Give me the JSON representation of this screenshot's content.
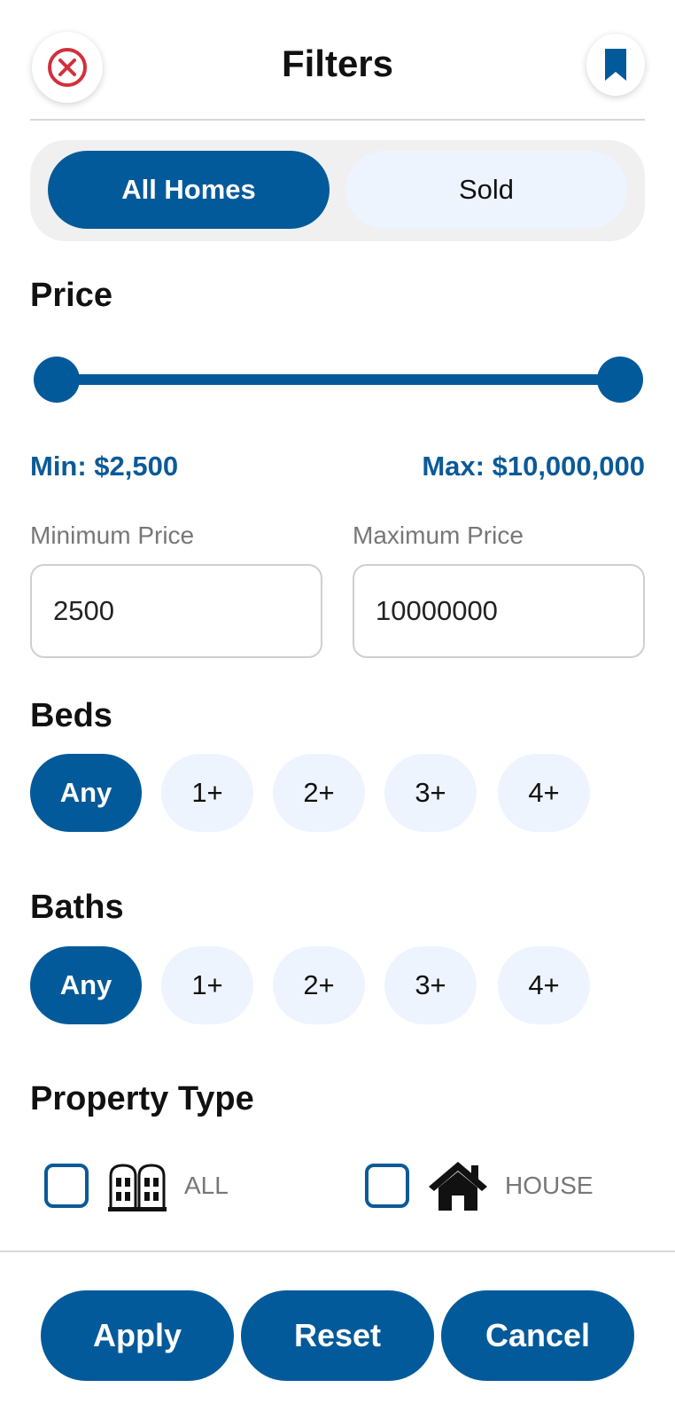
{
  "header": {
    "title": "Filters",
    "close_icon": "close-circle-icon",
    "bookmark_icon": "bookmark-icon"
  },
  "listing_toggle": {
    "options": [
      "All Homes",
      "Sold"
    ],
    "selected": "All Homes"
  },
  "price": {
    "title": "Price",
    "min_display": "Min: $2,500",
    "max_display": "Max: $10,000,000",
    "min_label": "Minimum Price",
    "max_label": "Maximum Price",
    "min_value": "2500",
    "max_value": "10000000"
  },
  "beds": {
    "title": "Beds",
    "options": [
      "Any",
      "1+",
      "2+",
      "3+",
      "4+"
    ],
    "selected": "Any"
  },
  "baths": {
    "title": "Baths",
    "options": [
      "Any",
      "1+",
      "2+",
      "3+",
      "4+"
    ],
    "selected": "Any"
  },
  "property_type": {
    "title": "Property Type",
    "items": [
      {
        "label": "ALL",
        "icon": "buildings-icon",
        "checked": false
      },
      {
        "label": "HOUSE",
        "icon": "house-icon",
        "checked": false
      }
    ]
  },
  "actions": {
    "apply": "Apply",
    "reset": "Reset",
    "cancel": "Cancel"
  },
  "colors": {
    "primary": "#035a9a",
    "primary_text": "#0b5a97",
    "chip_bg": "#edf4fd",
    "close_red": "#d32f3c"
  }
}
